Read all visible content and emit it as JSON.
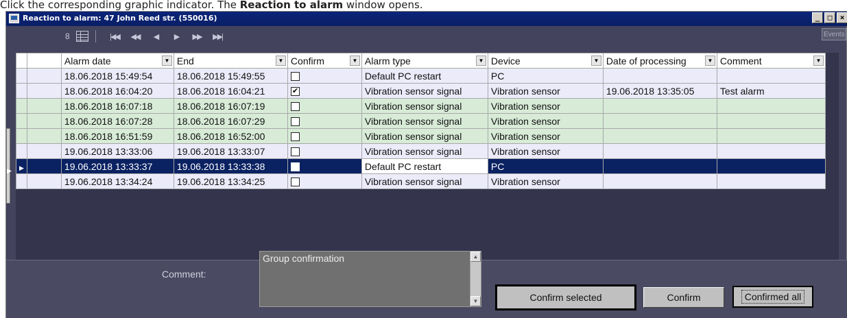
{
  "caption": {
    "prefix": "Click the corresponding graphic indicator. The ",
    "bold": "Reaction to alarm",
    "suffix": " window opens."
  },
  "window": {
    "title": "Reaction to alarm: 47 John Reed str. (550016)",
    "controls": [
      "_",
      "□",
      "×"
    ],
    "events_tooltip": "Events"
  },
  "navigator": {
    "count": "8",
    "buttons": [
      "first",
      "prev-page",
      "prev",
      "next",
      "next-page",
      "last"
    ],
    "glyphs": [
      "|◀◀",
      "◀◀",
      "◀",
      "▶",
      "▶▶",
      "▶▶|"
    ]
  },
  "grid": {
    "columns": [
      "Alarm date",
      "End",
      "Confirm",
      "Alarm type",
      "Device",
      "Date of processing",
      "Comment"
    ],
    "rows": [
      {
        "style": "lav",
        "alarm_date": "18.06.2018 15:49:54",
        "end": "18.06.2018 15:49:55",
        "confirmed": false,
        "alarm_type": "Default PC restart",
        "device": "PC",
        "date_processing": "",
        "comment": ""
      },
      {
        "style": "lav",
        "alarm_date": "18.06.2018 16:04:20",
        "end": "18.06.2018 16:04:21",
        "confirmed": true,
        "alarm_type": "Vibration sensor signal",
        "device": "Vibration sensor",
        "date_processing": "19.06.2018 13:35:05",
        "comment": "Test alarm"
      },
      {
        "style": "grn",
        "alarm_date": "18.06.2018 16:07:18",
        "end": "18.06.2018 16:07:19",
        "confirmed": false,
        "alarm_type": "Vibration sensor signal",
        "device": "Vibration sensor",
        "date_processing": "",
        "comment": ""
      },
      {
        "style": "grn",
        "alarm_date": "18.06.2018 16:07:28",
        "end": "18.06.2018 16:07:29",
        "confirmed": false,
        "alarm_type": "Vibration sensor signal",
        "device": "Vibration sensor",
        "date_processing": "",
        "comment": ""
      },
      {
        "style": "grn",
        "alarm_date": "18.06.2018 16:51:59",
        "end": "18.06.2018 16:52:00",
        "confirmed": false,
        "alarm_type": "Vibration sensor signal",
        "device": "Vibration sensor",
        "date_processing": "",
        "comment": ""
      },
      {
        "style": "lav",
        "alarm_date": "19.06.2018 13:33:06",
        "end": "19.06.2018 13:33:07",
        "confirmed": false,
        "alarm_type": "Vibration sensor signal",
        "device": "Vibration sensor",
        "date_processing": "",
        "comment": ""
      },
      {
        "style": "sel",
        "alarm_date": "19.06.2018 13:33:37",
        "end": "19.06.2018 13:33:38",
        "confirmed": false,
        "alarm_type": "Default PC restart",
        "device": "PC",
        "date_processing": "",
        "comment": ""
      },
      {
        "style": "lav",
        "alarm_date": "19.06.2018 13:34:24",
        "end": "19.06.2018 13:34:25",
        "confirmed": false,
        "alarm_type": "Vibration sensor signal",
        "device": "Vibration sensor",
        "date_processing": "",
        "comment": ""
      }
    ]
  },
  "bottom": {
    "comment_label": "Comment:",
    "comment_value": "Group confirmation",
    "btn_confirm_selected": "Confirm selected",
    "btn_confirm": "Confirm",
    "btn_confirmed_all": "Confirmed all"
  },
  "colors": {
    "row_lavender": "#ebebfa",
    "row_green": "#d7ebd7",
    "row_selected": "#0a2162",
    "window_bg": "#43435d"
  }
}
